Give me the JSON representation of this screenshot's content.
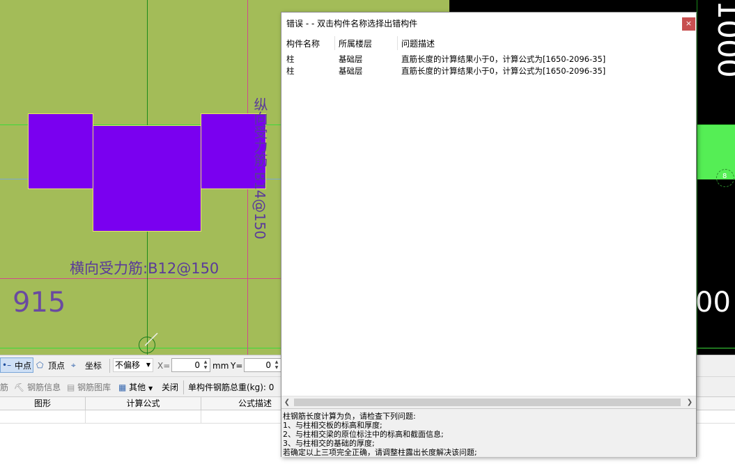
{
  "dialog": {
    "title": "错误 - - 双击构件名称选择出错构件",
    "close_icon": "×",
    "columns": [
      "构件名称",
      "所属楼层",
      "问题描述"
    ],
    "rows": [
      {
        "name": "柱",
        "floor": "基础层",
        "desc": "直筋长度的计算结果小于0，计算公式为[1650-2096-35]"
      },
      {
        "name": "柱",
        "floor": "基础层",
        "desc": "直筋长度的计算结果小于0，计算公式为[1650-2096-35]"
      }
    ],
    "message_lines": [
      "柱钢筋长度计算为负，请检查下列问题:",
      "1、与柱相交板的标高和厚度;",
      "2、与柱相交梁的原位标注中的标高和截面信息;",
      "3、与柱相交的基础的厚度;",
      "若确定以上三项完全正确，请调整柱露出长度解决该问题;"
    ]
  },
  "canvas": {
    "vertical_label": "纵向受力筋:B14@150",
    "horizontal_label": "横向受力筋:B12@150",
    "dimension_left": "915",
    "dimension_right": "00",
    "dimension_top_right": "1000",
    "snap_marker_right": "8",
    "colors": {
      "background": "#a3bc58",
      "shape": "#7a00f0",
      "band": "#55ee55"
    }
  },
  "toolbar1": {
    "midpoint": "中点",
    "vertex": "顶点",
    "coordinate": "坐标",
    "offset_select": "不偏移",
    "x_label": "X=",
    "x_value": "0",
    "unit_mm": "mm",
    "y_label": "Y=",
    "y_value": "0"
  },
  "toolbar2": {
    "rebar_partial": "筋",
    "rebar_info": "钢筋信息",
    "rebar_library": "钢筋图库",
    "other": "其他",
    "close": "关闭",
    "total_weight": "单构件钢筋总重(kg): 0"
  },
  "grid": {
    "headers": [
      "图形",
      "计算公式",
      "公式描述"
    ]
  }
}
